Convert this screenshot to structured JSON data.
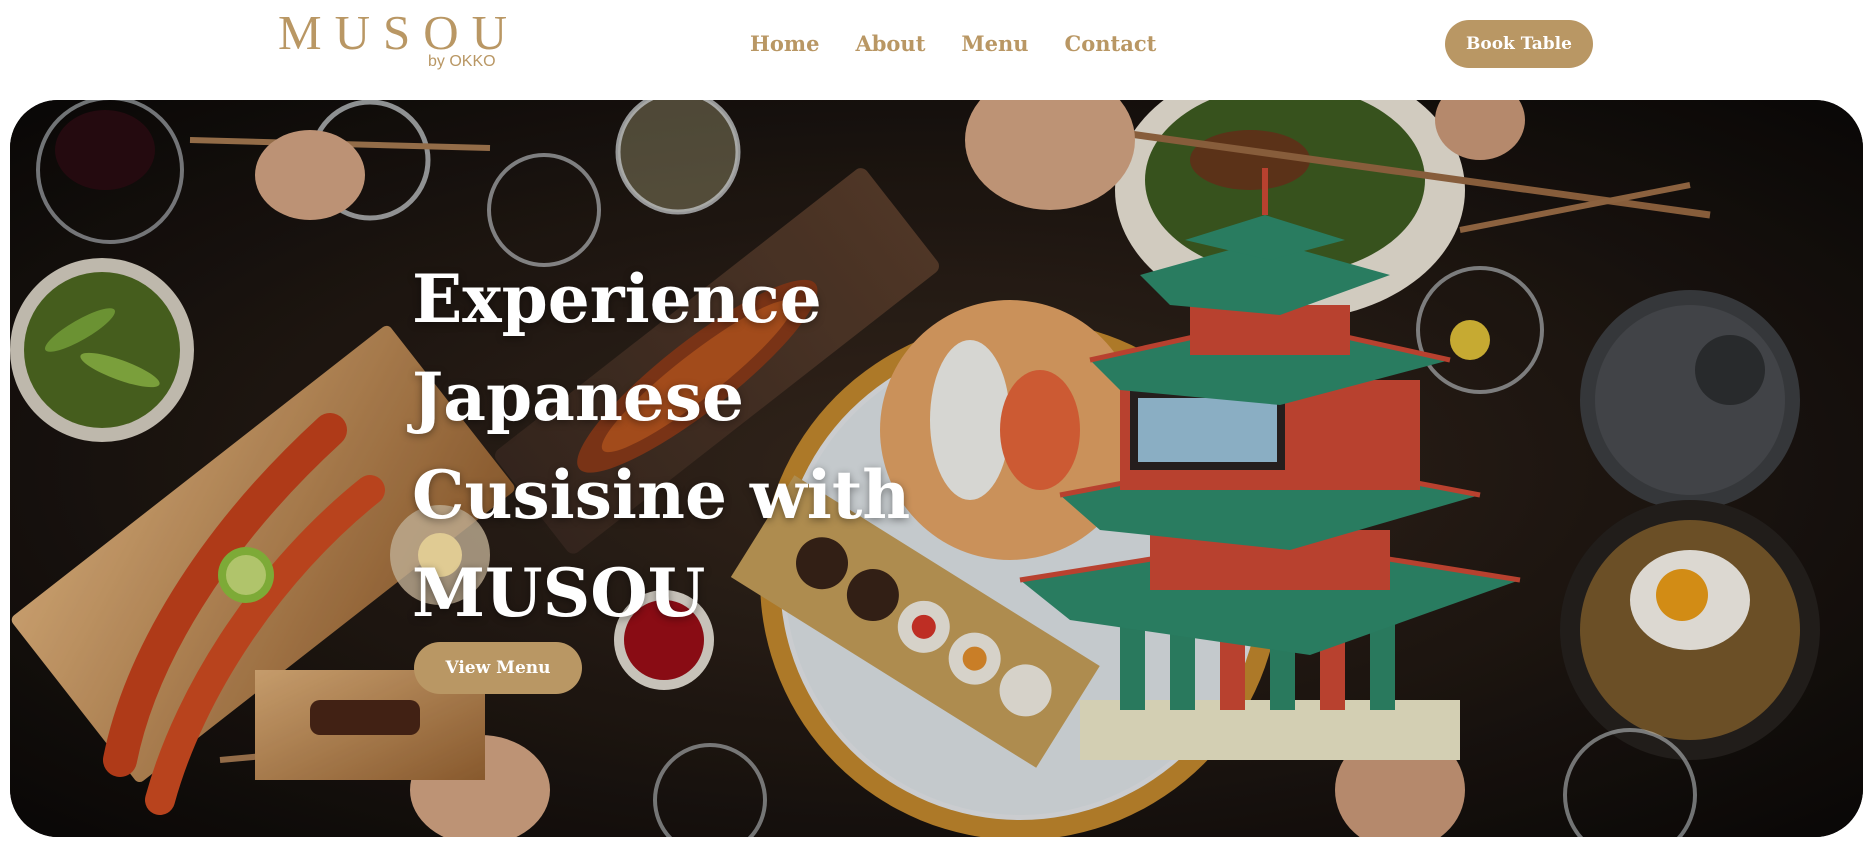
{
  "brand": {
    "name": "MUSOU",
    "sub": "by OKKO"
  },
  "nav": {
    "items": [
      "Home",
      "About",
      "Menu",
      "Contact"
    ],
    "cta": "Book Table"
  },
  "hero": {
    "lines": [
      "Experience",
      "Japanese",
      "Cusisine with",
      "MUSOU"
    ],
    "cta": "View Menu"
  },
  "colors": {
    "accent": "#b99764",
    "background": "#ffffff",
    "hero_dark": "#141110"
  }
}
